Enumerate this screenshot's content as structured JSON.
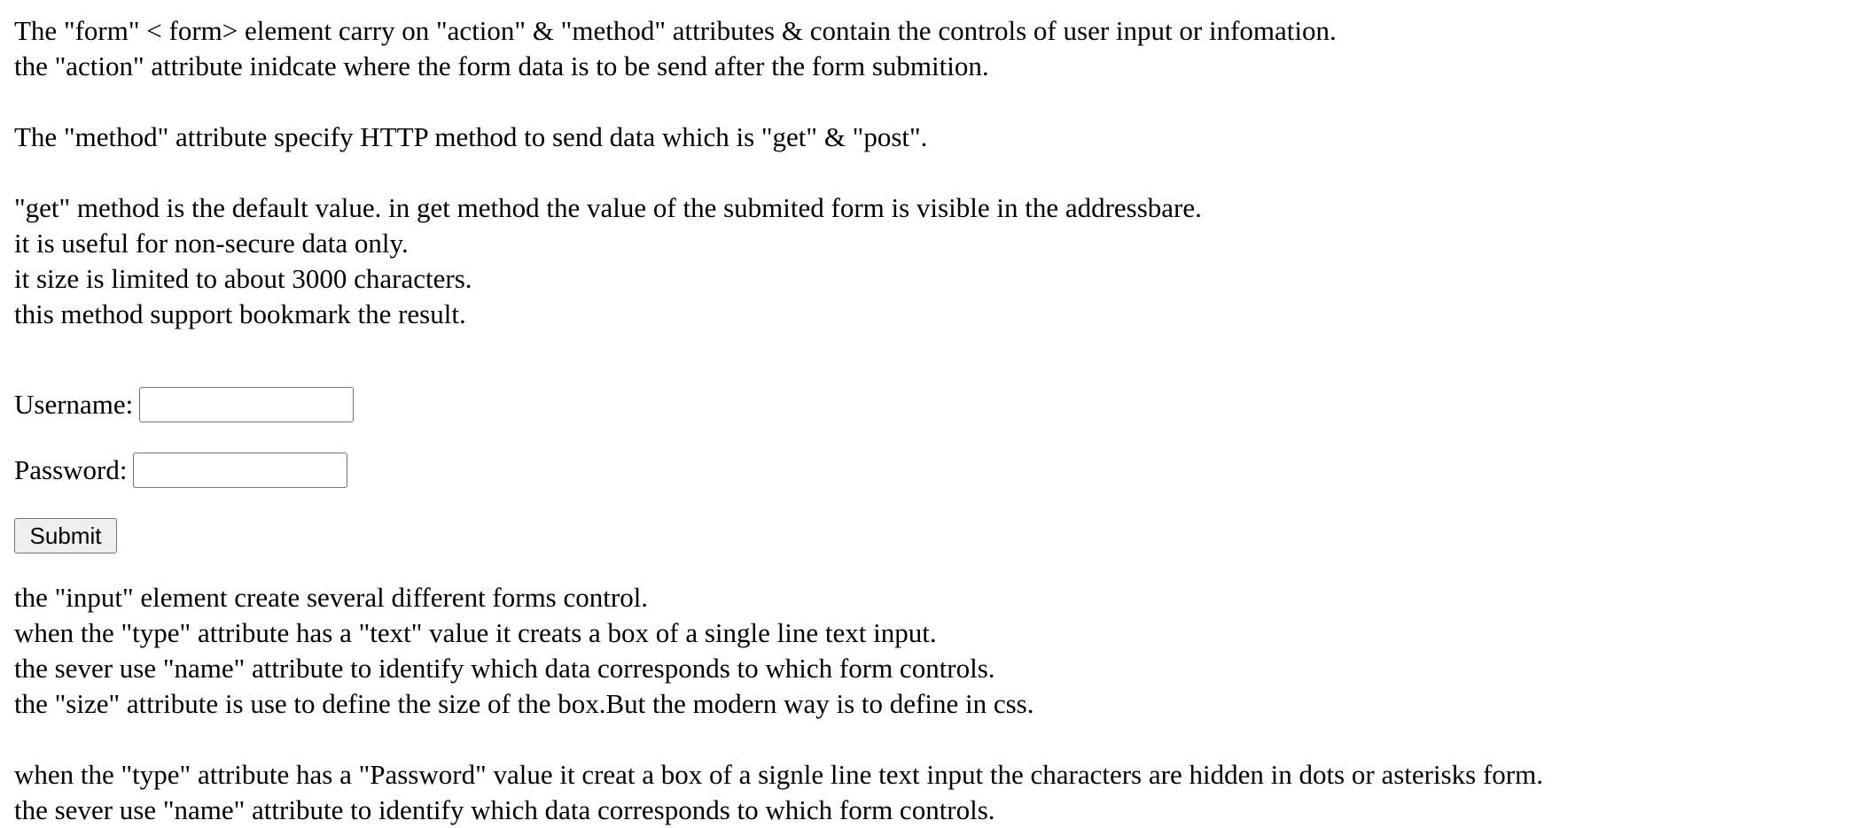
{
  "intro": {
    "line1": "The \"form\" < form> element carry on \"action\" & \"method\" attributes & contain the controls of user input or infomation.",
    "line2": "the \"action\" attribute inidcate where the form data is to be send after the form submition."
  },
  "method_para": {
    "line1": "The \"method\" attribute specify HTTP method to send data which is \"get\" & \"post\"."
  },
  "get_para": {
    "line1": "\"get\" method is the default value. in get method the value of the submited form is visible in the addressbare.",
    "line2": "it is useful for non-secure data only.",
    "line3": "it size is limited to about 3000 characters.",
    "line4": "this method support bookmark the result."
  },
  "form": {
    "username_label": "Username:",
    "password_label": "Password:",
    "submit_label": "Submit"
  },
  "input_para": {
    "line1": "the \"input\" element create several different forms control.",
    "line2": "when the \"type\" attribute has a \"text\" value it creats a box of a single line text input.",
    "line3": "the sever use \"name\" attribute to identify which data corresponds to which form controls.",
    "line4": "the \"size\" attribute is use to define the size of the box.But the modern way is to define in css."
  },
  "password_para": {
    "line1": "when the \"type\" attribute has a \"Password\" value it creat a box of a signle line text input the characters are hidden in dots or asterisks form.",
    "line2": "the sever use \"name\" attribute to identify which data corresponds to which form controls."
  }
}
